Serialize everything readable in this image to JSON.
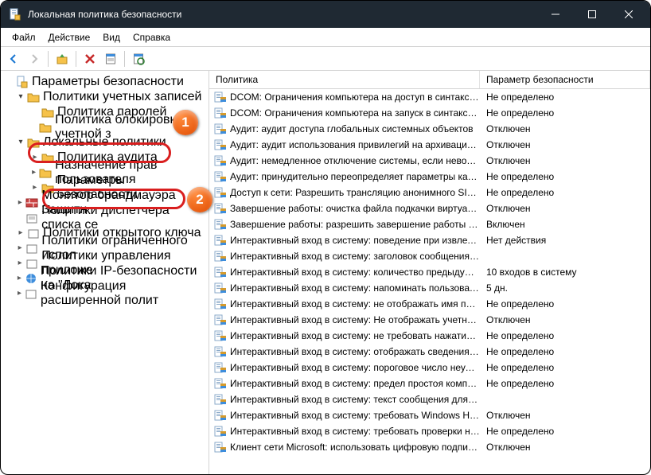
{
  "title": "Локальная политика безопасности",
  "menu": {
    "file": "Файл",
    "action": "Действие",
    "view": "Вид",
    "help": "Справка"
  },
  "tree": {
    "root": "Параметры безопасности",
    "n1": "Политики учетных записей",
    "n1a": "Политика паролей",
    "n1b": "Политика блокировки учетной з",
    "n2": "Локальные политики",
    "n2a": "Политика аудита",
    "n2b": "Назначение прав пользователя",
    "n2c": "Параметры безопасности",
    "n3": "Монитор брандмауэра Защитн",
    "n4": "Политики диспетчера списка се",
    "n5": "Политики открытого ключа",
    "n6": "Политики ограниченного испол",
    "n7": "Политики управления приложе",
    "n8": "Политики IP-безопасности на \"Лока",
    "n9": "Конфигурация расширенной полит"
  },
  "columns": {
    "policy": "Политика",
    "setting": "Параметр безопасности"
  },
  "rows": [
    {
      "p": "DCOM: Ограничения компьютера на доступ в синтаксис…",
      "v": "Не определено"
    },
    {
      "p": "DCOM: Ограничения компьютера на запуск в синтаксисе…",
      "v": "Не определено"
    },
    {
      "p": "Аудит: аудит доступа глобальных системных объектов",
      "v": "Отключен"
    },
    {
      "p": "Аудит: аудит использования привилегий на архивацию и …",
      "v": "Отключен"
    },
    {
      "p": "Аудит: немедленное отключение системы, если невозмо…",
      "v": "Отключен"
    },
    {
      "p": "Аудит: принудительно переопределяет параметры катег…",
      "v": "Не определено"
    },
    {
      "p": "Доступ к сети: Разрешить трансляцию анонимного SID в …",
      "v": "Не определено"
    },
    {
      "p": "Завершение работы: очистка файла подкачки виртуальн…",
      "v": "Отключен"
    },
    {
      "p": "Завершение работы: разрешить завершение работы сис…",
      "v": "Включен"
    },
    {
      "p": "Интерактивный вход в систему:  поведение при извлечен…",
      "v": "Нет действия"
    },
    {
      "p": "Интерактивный вход в систему: заголовок сообщения дл…",
      "v": ""
    },
    {
      "p": "Интерактивный вход в систему: количество предыдущих…",
      "v": "10 входов в систему"
    },
    {
      "p": "Интерактивный вход в систему: напоминать пользовател…",
      "v": "5 дн."
    },
    {
      "p": "Интерактивный вход в систему: не отображать имя поль…",
      "v": "Не определено"
    },
    {
      "p": "Интерактивный вход в систему: Не отображать учетные д…",
      "v": "Отключен"
    },
    {
      "p": "Интерактивный вход в систему: не требовать нажатия CT…",
      "v": "Не определено"
    },
    {
      "p": "Интерактивный вход в систему: отображать сведения о п…",
      "v": "Не определено"
    },
    {
      "p": "Интерактивный вход в систему: пороговое число неудач…",
      "v": "Не определено"
    },
    {
      "p": "Интерактивный вход в систему: предел простоя компью…",
      "v": "Не определено"
    },
    {
      "p": "Интерактивный вход в систему: текст сообщения для по…",
      "v": ""
    },
    {
      "p": "Интерактивный вход в систему: требовать Windows Hello…",
      "v": "Отключен"
    },
    {
      "p": "Интерактивный вход в систему: требовать проверки на к…",
      "v": "Не определено"
    },
    {
      "p": "Клиент сети Microsoft: использовать цифровую подпись …",
      "v": "Отключен"
    }
  ],
  "annotations": {
    "one": "1",
    "two": "2"
  }
}
